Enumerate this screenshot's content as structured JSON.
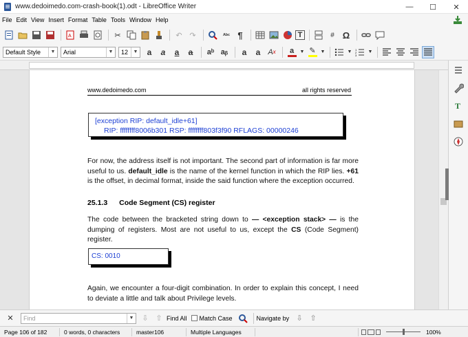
{
  "window": {
    "title": "www.dedoimedo.com-crash-book(1).odt - LibreOffice Writer",
    "min": "—",
    "max": "☐",
    "close": "✕"
  },
  "menu": [
    "File",
    "Edit",
    "View",
    "Insert",
    "Format",
    "Table",
    "Tools",
    "Window",
    "Help"
  ],
  "toolbar2": {
    "paragraph_style": "Default Style",
    "font_name": "Arial",
    "font_size": "12"
  },
  "page": {
    "header_left": "www.dedoimedo.com",
    "header_right": "all rights reserved",
    "code1_line1": "[exception  RIP:  default_idle+61]",
    "code1_line2": "RIP:  ffffffff8006b301  RSP:  ffffffff803f3f90  RFLAGS:  00000246",
    "para1": {
      "a": "For now, the address itself is not important. The second part of information is far more useful to us. ",
      "b": "default_idle",
      "c": " is the name of the kernel function in which the RIP lies. ",
      "d": "+61",
      "e": " is the offset, in decimal format, inside the said function where the exception occurred."
    },
    "heading": {
      "num": "25.1.3",
      "text": "Code Segment (CS) register"
    },
    "para2": {
      "a": "The code between the bracketed string down to ",
      "b": "—  <exception  stack>  —",
      "c": " is the dumping of registers. Most are not useful to us, except the ",
      "d": "CS",
      "e": " (Code Segment) register."
    },
    "code2": "CS:  0010",
    "para3": "Again, we encounter a four-digit combination. In order to explain this concept, I need to deviate a little and talk about Privilege levels."
  },
  "findbar": {
    "placeholder": "Find",
    "find_all": "Find All",
    "match_case": "Match Case",
    "navigate_by": "Navigate by"
  },
  "status": {
    "page": "Page 106 of 182",
    "words": "0 words, 0 characters",
    "style": "master106",
    "language": "Multiple Languages",
    "zoom": "100%"
  },
  "colors": {
    "accent": "#1c3fd4",
    "font_color_bar": "#c9211e",
    "highlight_bar": "#ffff00"
  }
}
